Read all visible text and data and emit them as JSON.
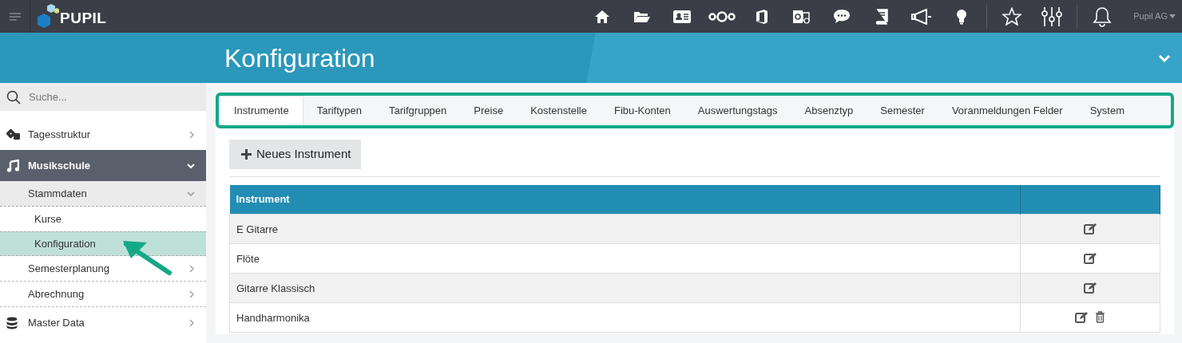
{
  "topbar": {
    "logo": "PUPIL",
    "user": "Pupil AG"
  },
  "header": {
    "title": "Konfiguration"
  },
  "sidebar": {
    "search": {
      "placeholder": "Suche..."
    },
    "items": [
      {
        "label": "Tagesstruktur",
        "expanded": false
      },
      {
        "label": "Musikschule",
        "expanded": true,
        "children": [
          {
            "label": "Stammdaten",
            "expanded": true,
            "children": [
              {
                "label": "Kurse",
                "selected": false
              },
              {
                "label": "Konfiguration",
                "selected": true
              }
            ]
          },
          {
            "label": "Semesterplanung",
            "expanded": false
          },
          {
            "label": "Abrechnung",
            "expanded": false
          }
        ]
      },
      {
        "label": "Master Data",
        "expanded": false
      }
    ]
  },
  "tabs": [
    {
      "label": "Instrumente",
      "selected": true
    },
    {
      "label": "Tariftypen",
      "selected": false
    },
    {
      "label": "Tarifgruppen",
      "selected": false
    },
    {
      "label": "Preise",
      "selected": false
    },
    {
      "label": "Kostenstelle",
      "selected": false
    },
    {
      "label": "Fibu-Konten",
      "selected": false
    },
    {
      "label": "Auswertungstags",
      "selected": false
    },
    {
      "label": "Absenztyp",
      "selected": false
    },
    {
      "label": "Semester",
      "selected": false
    },
    {
      "label": "Voranmeldungen Felder",
      "selected": false
    },
    {
      "label": "System",
      "selected": false
    }
  ],
  "new_button": {
    "label": "Neues Instrument"
  },
  "table": {
    "columns": [
      "Instrument"
    ],
    "rows": [
      {
        "name": "E Gitarre",
        "actions": [
          {
            "kind": "edit"
          }
        ]
      },
      {
        "name": "Flöte",
        "actions": [
          {
            "kind": "edit"
          }
        ]
      },
      {
        "name": "Gitarre Klassisch",
        "actions": [
          {
            "kind": "edit"
          }
        ]
      },
      {
        "name": "Handharmonika",
        "actions": [
          {
            "kind": "edit"
          },
          {
            "kind": "delete"
          }
        ]
      }
    ]
  }
}
